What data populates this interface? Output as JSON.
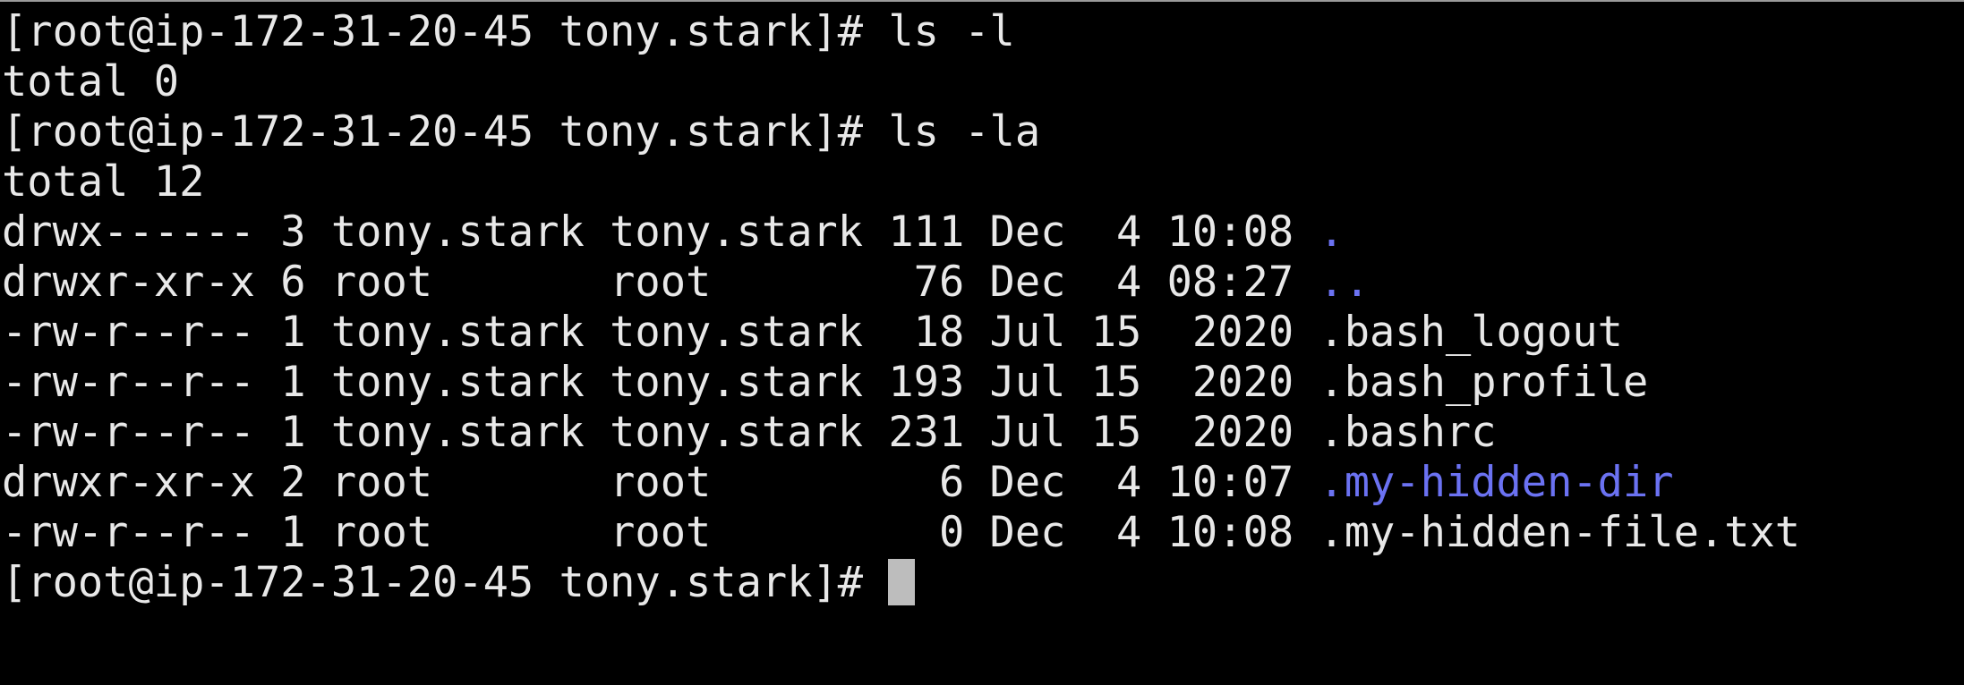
{
  "terminal": {
    "colors": {
      "background": "#000000",
      "text": "#e8e8e8",
      "directory": "#6b72f2",
      "cursor": "#bdbdbd"
    },
    "lines": [
      "[root@ip-172-31-20-45 tony.stark]# ls -l",
      "total 0",
      "[root@ip-172-31-20-45 tony.stark]# ls -la",
      "total 12"
    ],
    "listing": [
      {
        "prefix": "drwx------ 3 tony.stark tony.stark 111 Dec  4 10:08 ",
        "name": ".",
        "type": "directory"
      },
      {
        "prefix": "drwxr-xr-x 6 root       root        76 Dec  4 08:27 ",
        "name": "..",
        "type": "directory"
      },
      {
        "prefix": "-rw-r--r-- 1 tony.stark tony.stark  18 Jul 15  2020 ",
        "name": ".bash_logout",
        "type": "file"
      },
      {
        "prefix": "-rw-r--r-- 1 tony.stark tony.stark 193 Jul 15  2020 ",
        "name": ".bash_profile",
        "type": "file"
      },
      {
        "prefix": "-rw-r--r-- 1 tony.stark tony.stark 231 Jul 15  2020 ",
        "name": ".bashrc",
        "type": "file"
      },
      {
        "prefix": "drwxr-xr-x 2 root       root         6 Dec  4 10:07 ",
        "name": ".my-hidden-dir",
        "type": "directory"
      },
      {
        "prefix": "-rw-r--r-- 1 root       root         0 Dec  4 10:08 ",
        "name": ".my-hidden-file.txt",
        "type": "file"
      }
    ],
    "prompt": "[root@ip-172-31-20-45 tony.stark]# "
  }
}
